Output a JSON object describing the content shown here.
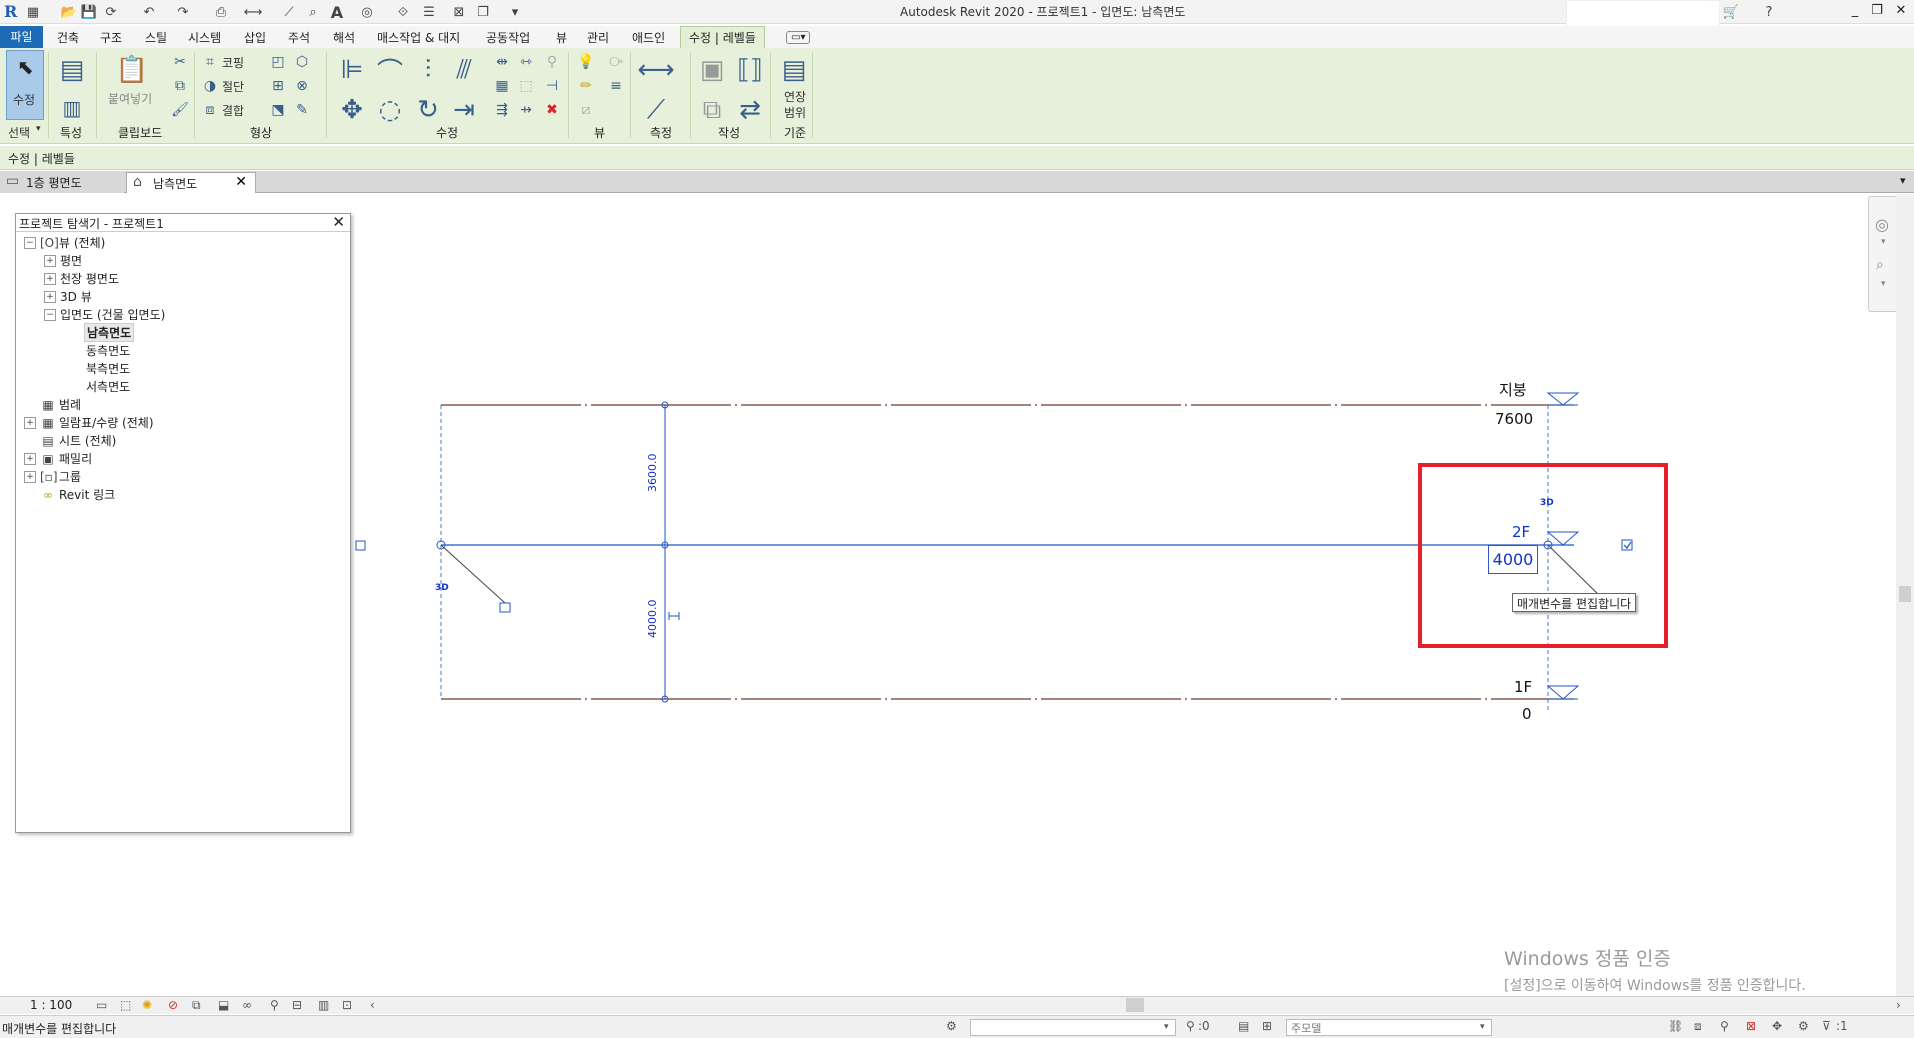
{
  "titlebar": {
    "title": "Autodesk Revit 2020 - 프로젝트1 - 입면도: 남측면도",
    "logo": "R"
  },
  "ribbon_tabs": [
    "파일",
    "건축",
    "구조",
    "스틸",
    "시스템",
    "삽입",
    "주석",
    "해석",
    "매스작업 & 대지",
    "공동작업",
    "뷰",
    "관리",
    "애드인",
    "수정 | 레벨들"
  ],
  "ribbon": {
    "modify_label": "수정",
    "select_label": "선택",
    "properties_label": "특성",
    "clipboard_label": "클립보드",
    "paste_label": "붙여넣기",
    "geometry_label": "형상",
    "cope_label": "코핑",
    "cut_label": "절단",
    "join_label": "결합",
    "modify_panel_label": "수정",
    "view_label": "뷰",
    "measure_label": "측정",
    "create_label": "작성",
    "datum_label": "기준",
    "extent_label_1": "연장",
    "extent_label_2": "범위"
  },
  "context_bar": {
    "text": "수정 | 레벨들"
  },
  "view_tabs": [
    {
      "label": "1층 평면도"
    },
    {
      "label": "남측면도"
    }
  ],
  "browser": {
    "title": "프로젝트 탐색기 - 프로젝트1",
    "items": [
      {
        "label": "뷰 (전체)",
        "exp": "−",
        "icon": "[O]"
      },
      {
        "label": "평면",
        "exp": "+"
      },
      {
        "label": "천장 평면도",
        "exp": "+"
      },
      {
        "label": "3D 뷰",
        "exp": "+"
      },
      {
        "label": "입면도 (건물 입면도)",
        "exp": "−"
      },
      {
        "label": "남측면도"
      },
      {
        "label": "동측면도"
      },
      {
        "label": "북측면도"
      },
      {
        "label": "서측면도"
      },
      {
        "label": "범례",
        "icon": "▦"
      },
      {
        "label": "일람표/수량 (전체)",
        "exp": "+",
        "icon": "▦"
      },
      {
        "label": "시트 (전체)",
        "icon": "▤"
      },
      {
        "label": "패밀리",
        "exp": "+",
        "icon": "▣"
      },
      {
        "label": "그룹",
        "exp": "+",
        "icon": "[▫]"
      },
      {
        "label": "Revit 링크",
        "icon": "∞"
      }
    ]
  },
  "levels": [
    {
      "name": "지붕",
      "elevation": "7600"
    },
    {
      "name": "2F",
      "elevation": "4000"
    },
    {
      "name": "1F",
      "elevation": "0"
    }
  ],
  "dimensions": {
    "upper": "3600.0",
    "lower": "4000.0"
  },
  "tag_3d": "3D",
  "tooltip": "매개변수를 편집합니다",
  "watermark": {
    "line1": "Windows 정품 인증",
    "line2": "[설정]으로 이동하여 Windows를 정품 인증합니다."
  },
  "viewbar": {
    "scale": "1 : 100"
  },
  "statusbar": {
    "message": "매개변수를 편집합니다",
    "selection_count": ":0",
    "model_placeholder": "주모델",
    "filter_count": ":1"
  },
  "colors": {
    "highlight": "#e3202b",
    "level_line": "#6b3a2a",
    "selected": "#1133cc",
    "ribbon": "#e6f0da"
  }
}
